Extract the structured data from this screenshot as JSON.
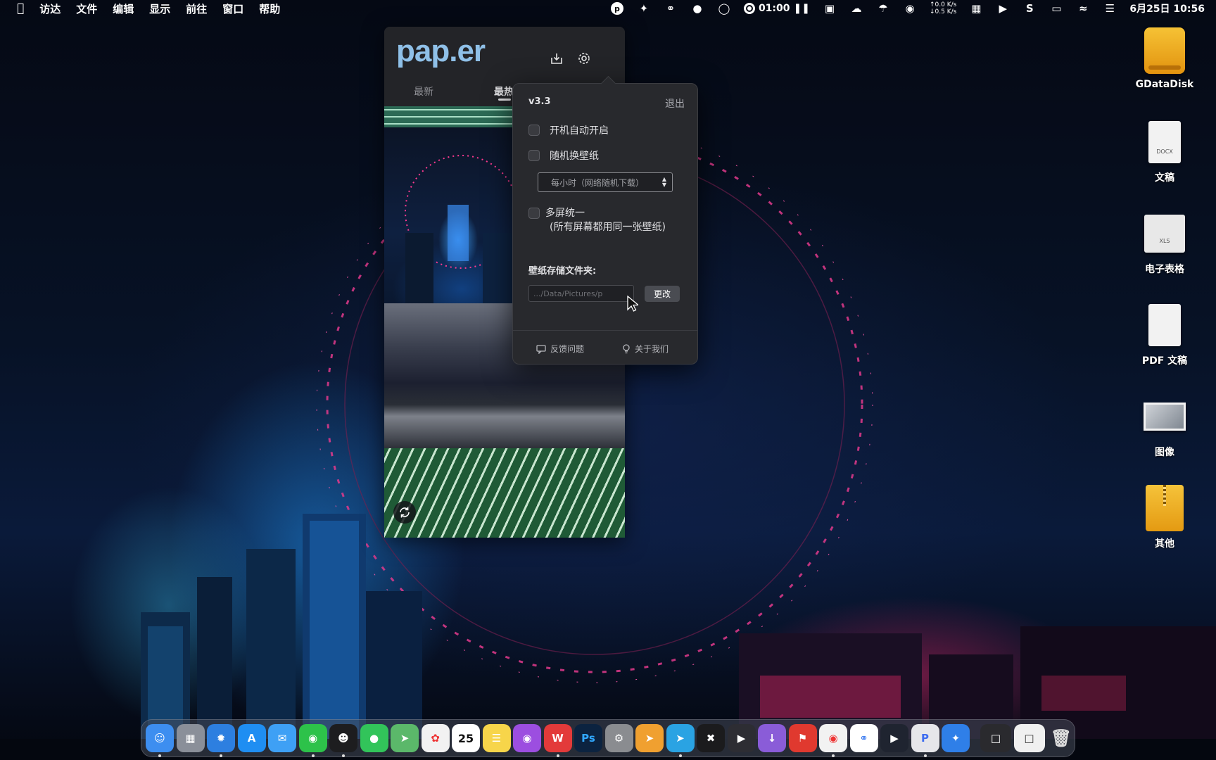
{
  "menubar": {
    "apple_icon": "apple-icon",
    "items": [
      "访达",
      "文件",
      "编辑",
      "显示",
      "前往",
      "窗口",
      "帮助"
    ],
    "status": {
      "timer": "01:00",
      "net_up": "0.0 K/s",
      "net_down": "0.5 K/s",
      "clock": "6月25日  10:56"
    }
  },
  "app": {
    "logo": "pap.er",
    "tabs": [
      "最新",
      "最热"
    ],
    "active_tab": "最热",
    "thumbnails": [
      "green-stripes",
      "london-eye-night",
      "stormy-sea",
      "calathea-leaves"
    ]
  },
  "settings": {
    "version": "v3.3",
    "quit_label": "退出",
    "auto_start_label": "开机自动开启",
    "auto_start_checked": false,
    "random_wallpaper_label": "随机换壁纸",
    "random_wallpaper_checked": false,
    "interval_selected": "每小时（网络随机下载）",
    "multi_screen_label": "多屏统一",
    "multi_screen_sub": "(所有屏幕都用同一张壁纸)",
    "multi_screen_checked": false,
    "folder_label": "壁纸存储文件夹:",
    "folder_path": ".../Data/Pictures/p",
    "change_label": "更改",
    "feedback_label": "反馈问题",
    "about_label": "关于我们"
  },
  "desktop": {
    "items": [
      {
        "label": "GDataDisk",
        "icon": "drive-icon"
      },
      {
        "label": "文稿",
        "icon": "docx-icon",
        "badge": "DOCX"
      },
      {
        "label": "电子表格",
        "icon": "xls-icon",
        "badge": "XLS"
      },
      {
        "label": "PDF 文稿",
        "icon": "pdf-icon"
      },
      {
        "label": "图像",
        "icon": "image-icon"
      },
      {
        "label": "其他",
        "icon": "zip-icon"
      }
    ]
  },
  "dock": {
    "calendar_day": "25",
    "photoshop_label": "Ps",
    "apps": [
      {
        "name": "finder",
        "color": "#3d8ef0"
      },
      {
        "name": "launchpad",
        "color": "#8a8f99"
      },
      {
        "name": "safari",
        "color": "#2d7fe0"
      },
      {
        "name": "app-store",
        "color": "#1f8ef2"
      },
      {
        "name": "mail",
        "color": "#3ea0f5"
      },
      {
        "name": "wechat",
        "color": "#2dc24a"
      },
      {
        "name": "qq",
        "color": "#1d1d1f"
      },
      {
        "name": "messages",
        "color": "#32c45a"
      },
      {
        "name": "maps",
        "color": "#5bb86a"
      },
      {
        "name": "photos",
        "color": "#f2f2f2"
      },
      {
        "name": "calendar",
        "color": "#ffffff"
      },
      {
        "name": "notes",
        "color": "#f7d54a"
      },
      {
        "name": "podcasts",
        "color": "#9c4ee0"
      },
      {
        "name": "wps",
        "color": "#e33a3a"
      },
      {
        "name": "photoshop",
        "color": "#0c2340"
      },
      {
        "name": "system-preferences",
        "color": "#8a8c90"
      },
      {
        "name": "rocket",
        "color": "#f0a030"
      },
      {
        "name": "telegram",
        "color": "#2aa3e3"
      },
      {
        "name": "capcut",
        "color": "#1b1b1d"
      },
      {
        "name": "final-cut",
        "color": "#2d2d33"
      },
      {
        "name": "downie",
        "color": "#8a5cd8"
      },
      {
        "name": "pdf-expert",
        "color": "#e0392f"
      },
      {
        "name": "chrome",
        "color": "#f2f2f2"
      },
      {
        "name": "pap-er",
        "color": "#ffffff"
      },
      {
        "name": "infuse",
        "color": "#1f2430"
      },
      {
        "name": "pap-er-pink",
        "color": "#e6e6ea"
      },
      {
        "name": "bird",
        "color": "#2f7fe8"
      }
    ]
  }
}
